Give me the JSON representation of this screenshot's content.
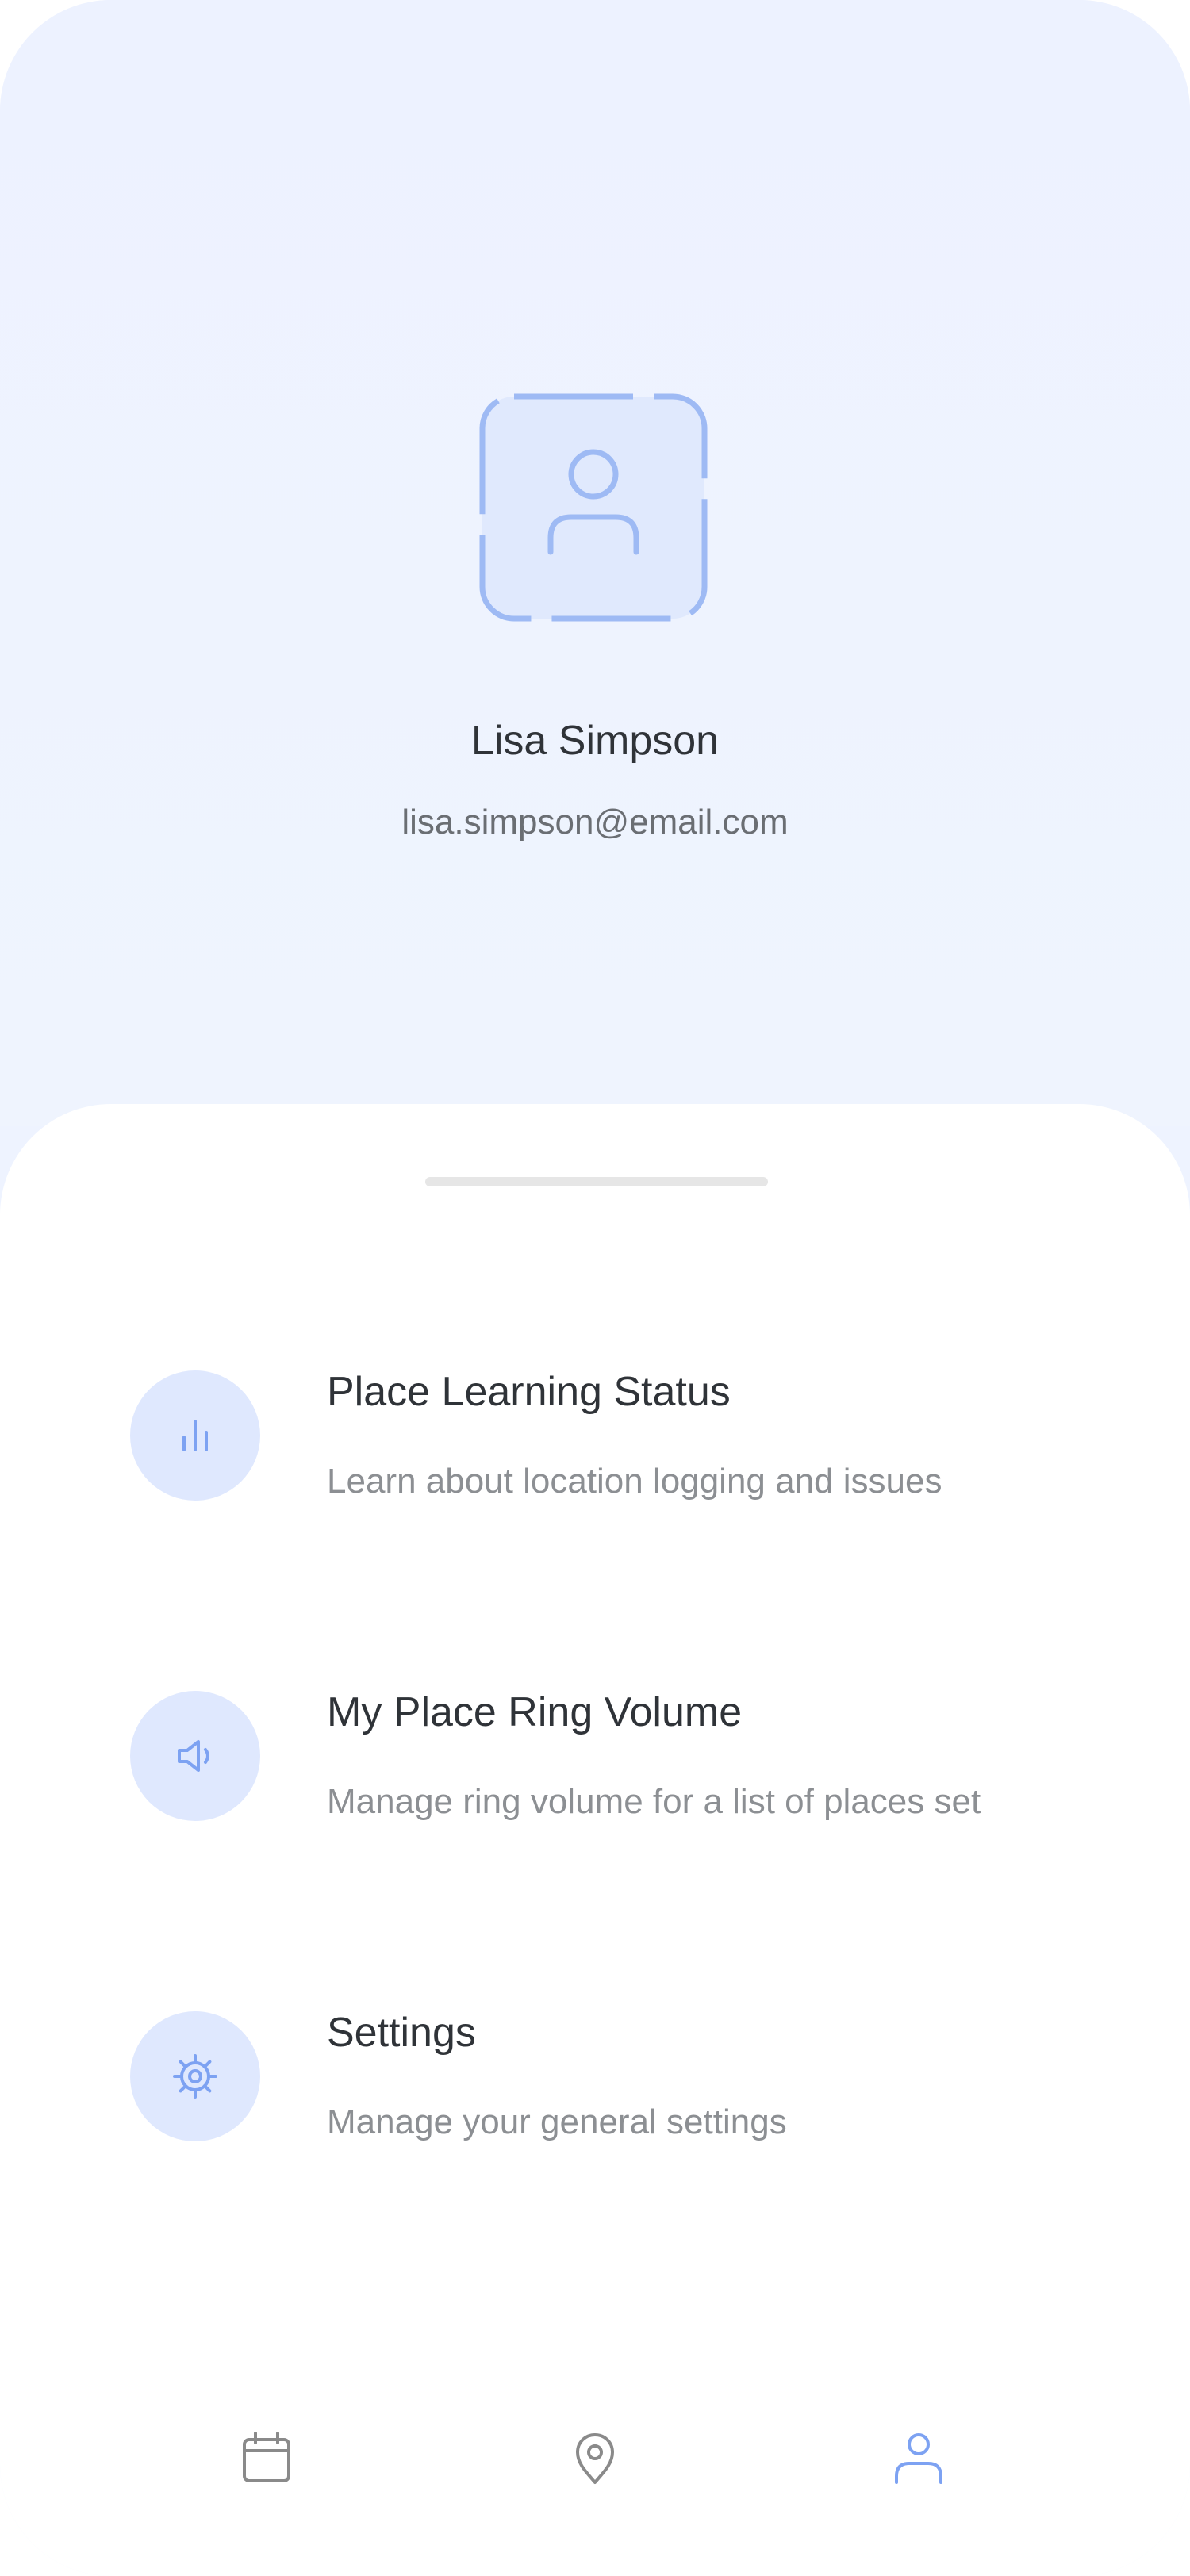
{
  "profile": {
    "name": "Lisa Simpson",
    "email": "lisa.simpson@email.com",
    "avatar_icon": "user-icon"
  },
  "menu": {
    "items": [
      {
        "title": "Place Learning Status",
        "subtitle": "Learn about location logging and issues",
        "icon": "bar-chart-icon"
      },
      {
        "title": "My Place Ring Volume",
        "subtitle": "Manage ring volume for a list of places set",
        "icon": "speaker-icon"
      },
      {
        "title": "Settings",
        "subtitle": "Manage your general settings",
        "icon": "gear-icon"
      }
    ]
  },
  "tabbar": {
    "tabs": [
      {
        "icon": "calendar-icon",
        "active": false
      },
      {
        "icon": "location-pin-icon",
        "active": false
      },
      {
        "icon": "user-icon",
        "active": true
      }
    ]
  },
  "colors": {
    "accent": "#7da2f2",
    "icon_bg": "#dfe8fe",
    "header_bg": "#eef3ff",
    "inactive_icon": "#8a8a8a"
  }
}
